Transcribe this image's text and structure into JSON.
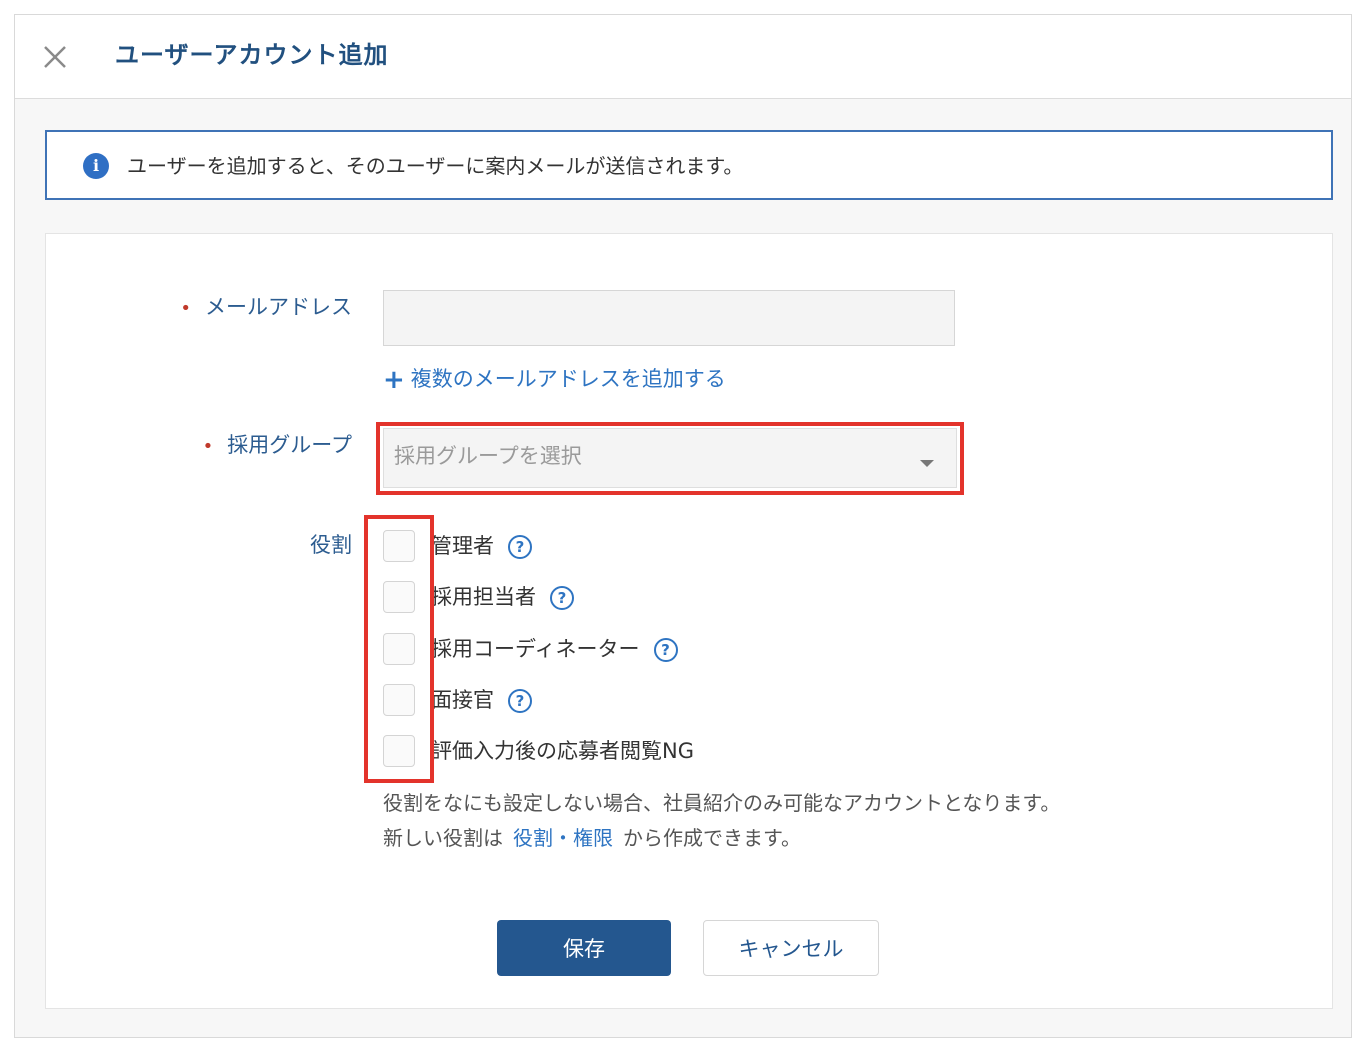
{
  "dialog": {
    "title": "ユーザーアカウント追加",
    "close_icon": "close-icon"
  },
  "info": {
    "icon": "info-icon",
    "icon_glyph": "i",
    "text": "ユーザーを追加すると、そのユーザーに案内メールが送信されます。"
  },
  "form": {
    "required_mark": "•",
    "email": {
      "label": "メールアドレス",
      "value": "",
      "placeholder": ""
    },
    "add_multiple": {
      "icon": "plus-icon",
      "glyph": "+",
      "label": "複数のメールアドレスを追加する"
    },
    "group": {
      "label": "採用グループ",
      "placeholder": "採用グループを選択"
    },
    "roles": {
      "label": "役割",
      "help_glyph": "?",
      "items": [
        {
          "label": "管理者",
          "checked": false,
          "help": true
        },
        {
          "label": "採用担当者",
          "checked": false,
          "help": true
        },
        {
          "label": "採用コーディネーター",
          "checked": false,
          "help": true
        },
        {
          "label": "面接官",
          "checked": false,
          "help": true
        },
        {
          "label": "評価入力後の応募者閲覧NG",
          "checked": false,
          "help": false
        }
      ],
      "note_line1": "役割をなにも設定しない場合、社員紹介のみ可能なアカウントとなります。",
      "note_line2_prefix": "新しい役割は",
      "note_line2_link": "役割・権限",
      "note_line2_suffix": "から作成できます。"
    }
  },
  "actions": {
    "save_label": "保存",
    "cancel_label": "キャンセル"
  },
  "colors": {
    "accent": "#24578f",
    "link": "#2e74c2",
    "highlight": "#e3332b",
    "required": "#c0392b"
  }
}
